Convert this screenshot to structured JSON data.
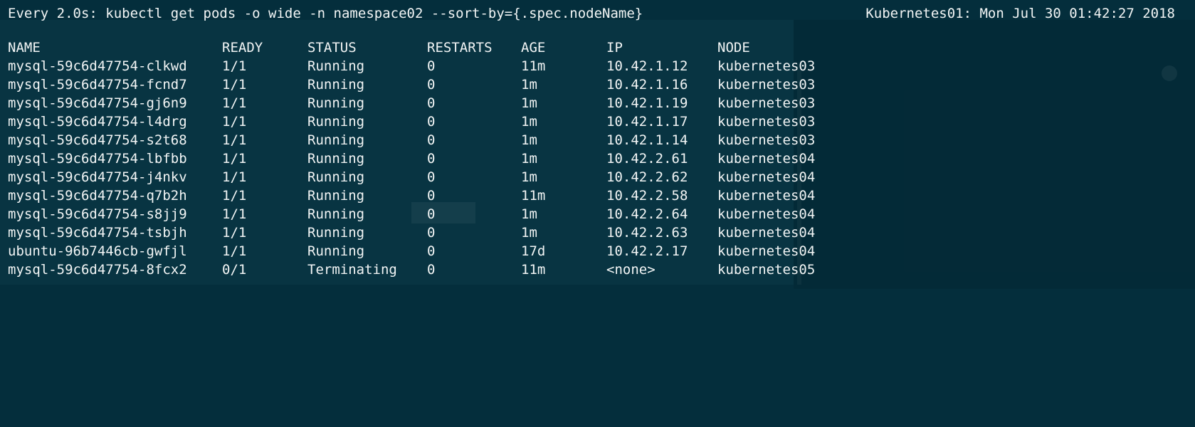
{
  "watch": {
    "command": "Every 2.0s: kubectl get pods -o wide -n namespace02 --sort-by={.spec.nodeName}",
    "host_time": "Kubernetes01: Mon Jul 30 01:42:27 2018"
  },
  "table": {
    "headers": {
      "name": "NAME",
      "ready": "READY",
      "status": "STATUS",
      "restarts": "RESTARTS",
      "age": "AGE",
      "ip": "IP",
      "node": "NODE"
    },
    "rows": [
      {
        "name": "mysql-59c6d47754-clkwd",
        "ready": "1/1",
        "status": "Running",
        "restarts": "0",
        "age": "11m",
        "ip": "10.42.1.12",
        "node": "kubernetes03"
      },
      {
        "name": "mysql-59c6d47754-fcnd7",
        "ready": "1/1",
        "status": "Running",
        "restarts": "0",
        "age": "1m",
        "ip": "10.42.1.16",
        "node": "kubernetes03"
      },
      {
        "name": "mysql-59c6d47754-gj6n9",
        "ready": "1/1",
        "status": "Running",
        "restarts": "0",
        "age": "1m",
        "ip": "10.42.1.19",
        "node": "kubernetes03"
      },
      {
        "name": "mysql-59c6d47754-l4drg",
        "ready": "1/1",
        "status": "Running",
        "restarts": "0",
        "age": "1m",
        "ip": "10.42.1.17",
        "node": "kubernetes03"
      },
      {
        "name": "mysql-59c6d47754-s2t68",
        "ready": "1/1",
        "status": "Running",
        "restarts": "0",
        "age": "1m",
        "ip": "10.42.1.14",
        "node": "kubernetes03"
      },
      {
        "name": "mysql-59c6d47754-lbfbb",
        "ready": "1/1",
        "status": "Running",
        "restarts": "0",
        "age": "1m",
        "ip": "10.42.2.61",
        "node": "kubernetes04"
      },
      {
        "name": "mysql-59c6d47754-j4nkv",
        "ready": "1/1",
        "status": "Running",
        "restarts": "0",
        "age": "1m",
        "ip": "10.42.2.62",
        "node": "kubernetes04"
      },
      {
        "name": "mysql-59c6d47754-q7b2h",
        "ready": "1/1",
        "status": "Running",
        "restarts": "0",
        "age": "11m",
        "ip": "10.42.2.58",
        "node": "kubernetes04"
      },
      {
        "name": "mysql-59c6d47754-s8jj9",
        "ready": "1/1",
        "status": "Running",
        "restarts": "0",
        "age": "1m",
        "ip": "10.42.2.64",
        "node": "kubernetes04"
      },
      {
        "name": "mysql-59c6d47754-tsbjh",
        "ready": "1/1",
        "status": "Running",
        "restarts": "0",
        "age": "1m",
        "ip": "10.42.2.63",
        "node": "kubernetes04"
      },
      {
        "name": "ubuntu-96b7446cb-gwfjl",
        "ready": "1/1",
        "status": "Running",
        "restarts": "0",
        "age": "17d",
        "ip": "10.42.2.17",
        "node": "kubernetes04"
      },
      {
        "name": "mysql-59c6d47754-8fcx2",
        "ready": "0/1",
        "status": "Terminating",
        "restarts": "0",
        "age": "11m",
        "ip": "<none>",
        "node": "kubernetes05"
      }
    ]
  },
  "colors": {
    "background": "#042e3c",
    "text": "#f2f5f5"
  }
}
